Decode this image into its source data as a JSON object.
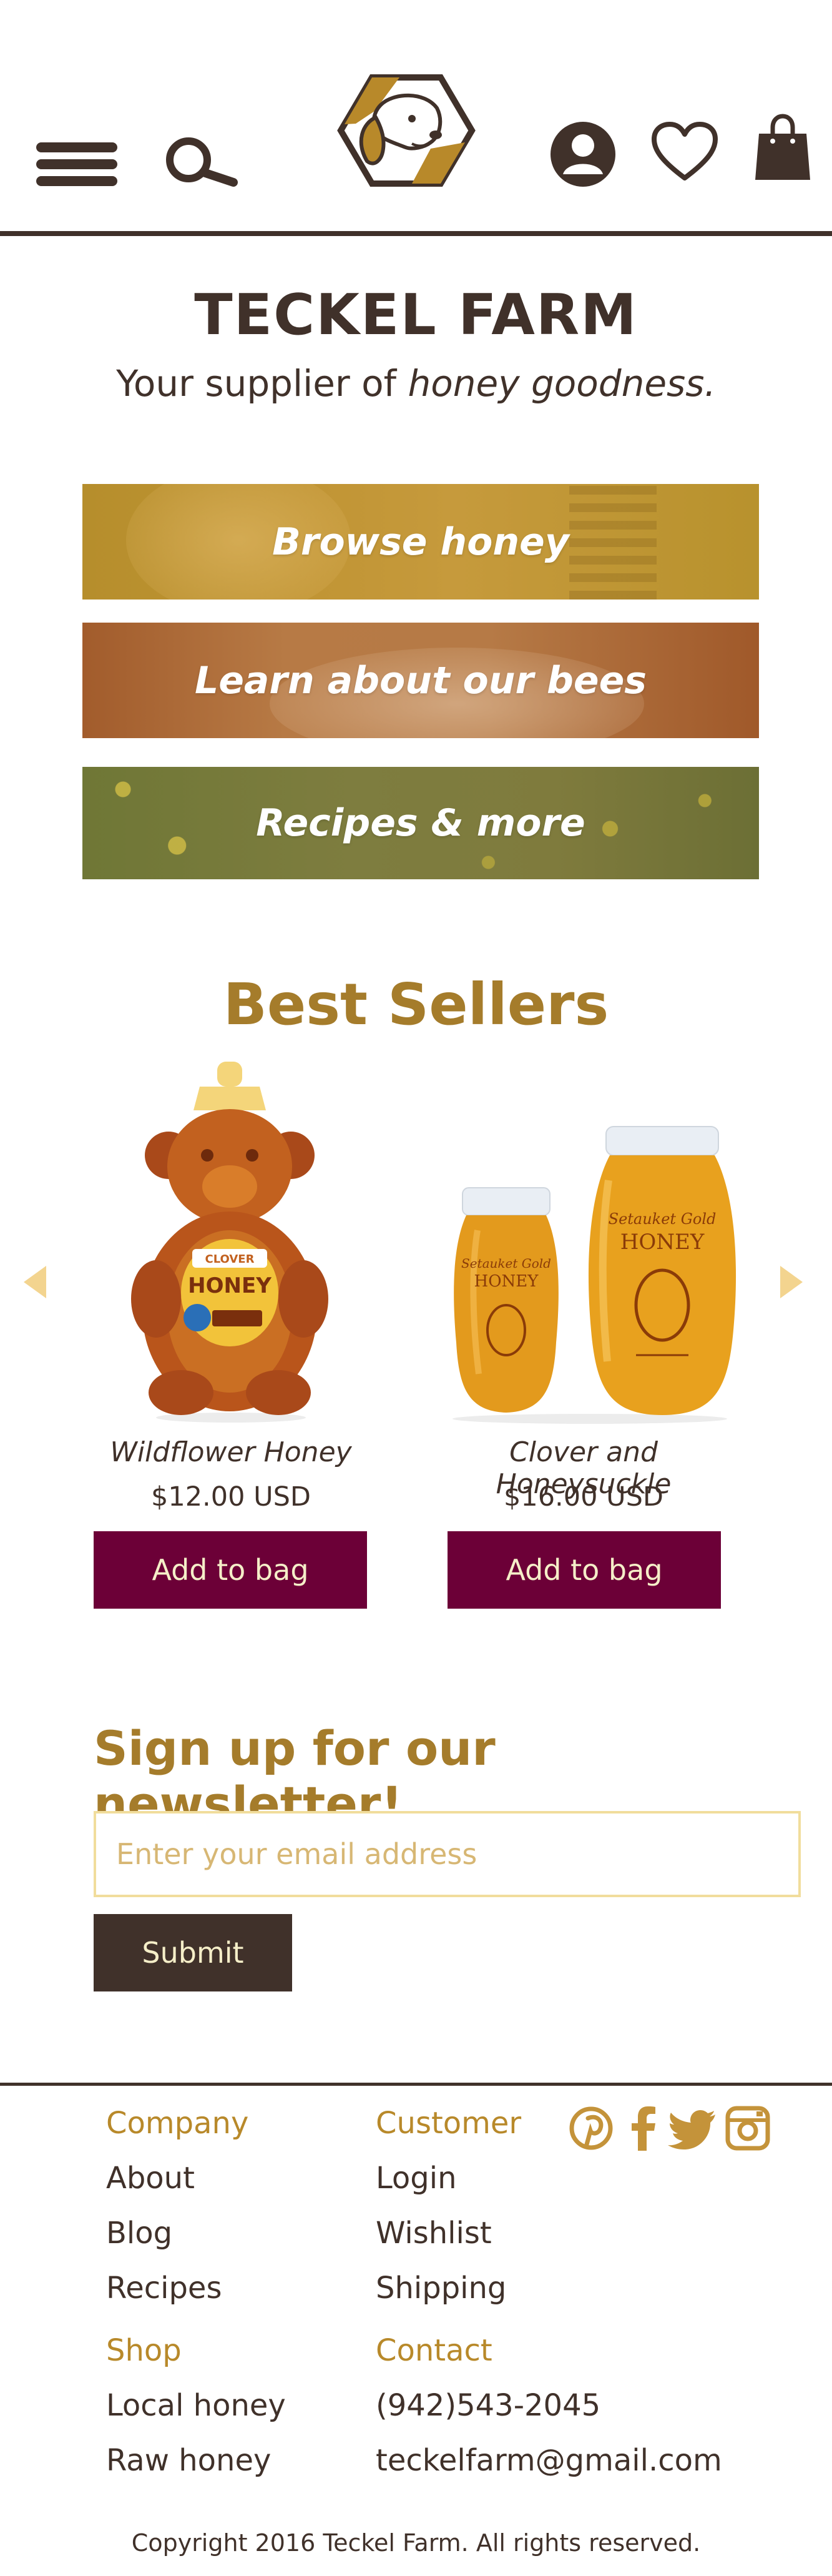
{
  "header": {
    "icons": [
      "menu-icon",
      "search-icon",
      "dog-logo",
      "account-icon",
      "heart-icon",
      "bag-icon"
    ]
  },
  "hero": {
    "brand": "TECKEL FARM",
    "tagline_prefix": "Your supplier of ",
    "tagline_emphasis": "honey goodness."
  },
  "promos": [
    {
      "label": "Browse honey"
    },
    {
      "label": "Learn about our bees"
    },
    {
      "label": "Recipes & more"
    }
  ],
  "best_sellers": {
    "title": "Best Sellers",
    "products": [
      {
        "name": "Wildflower Honey",
        "price": "$12.00 USD",
        "button": "Add to bag",
        "jar_label": "HONEY",
        "jar_sublabel": "CLOVER"
      },
      {
        "name": "Clover and Honeysuckle",
        "price": "$16.00 USD",
        "button": "Add to bag",
        "jar_label": "HONEY",
        "jar_sublabel": "Setauket Gold"
      }
    ]
  },
  "newsletter": {
    "title": "Sign up for our newsletter!",
    "email_placeholder": "Enter your email address",
    "email_value": "",
    "submit": "Submit"
  },
  "footer": {
    "company": {
      "heading": "Company",
      "links": [
        "About",
        "Blog",
        "Recipes"
      ]
    },
    "customer": {
      "heading": "Customer",
      "links": [
        "Login",
        "Wishlist",
        "Shipping"
      ]
    },
    "shop": {
      "heading": "Shop",
      "links": [
        "Local honey",
        "Raw honey"
      ]
    },
    "contact": {
      "heading": "Contact",
      "phone": "(942)543-2045",
      "email": "teckelfarm@gmail.com"
    },
    "social": [
      "pinterest-icon",
      "facebook-icon",
      "twitter-icon",
      "instagram-icon"
    ],
    "copyright": "Copyright 2016 Teckel Farm. All rights reserved."
  },
  "colors": {
    "brand_dark": "#40312a",
    "gold": "#a57c2b",
    "button_wine": "#6c0037",
    "input_border": "#f1dd9c",
    "arrow": "#f3d48f"
  }
}
